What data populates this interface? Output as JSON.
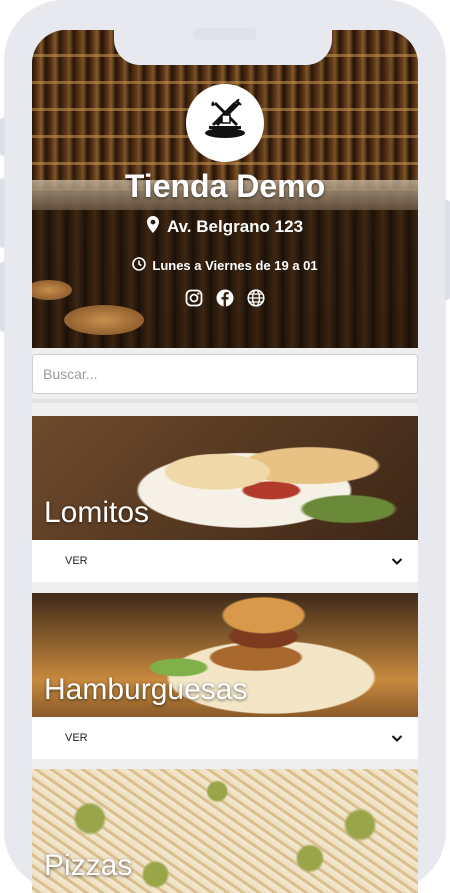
{
  "store": {
    "name": "Tienda Demo",
    "address": "Av. Belgrano 123",
    "hours": "Lunes a Viernes de 19 a 01"
  },
  "icons": {
    "logo": "fork-knife-plate-icon",
    "address": "map-pin-icon",
    "hours": "clock-icon",
    "socials": [
      "instagram-icon",
      "facebook-icon",
      "globe-icon"
    ]
  },
  "search": {
    "placeholder": "Buscar..."
  },
  "categories": [
    {
      "title": "Lomitos",
      "action": "VER"
    },
    {
      "title": "Hamburguesas",
      "action": "VER"
    },
    {
      "title": "Pizzas"
    }
  ],
  "colors": {
    "header_text": "#ffffff",
    "background": "#efefef",
    "device": "#e7e9ee"
  }
}
